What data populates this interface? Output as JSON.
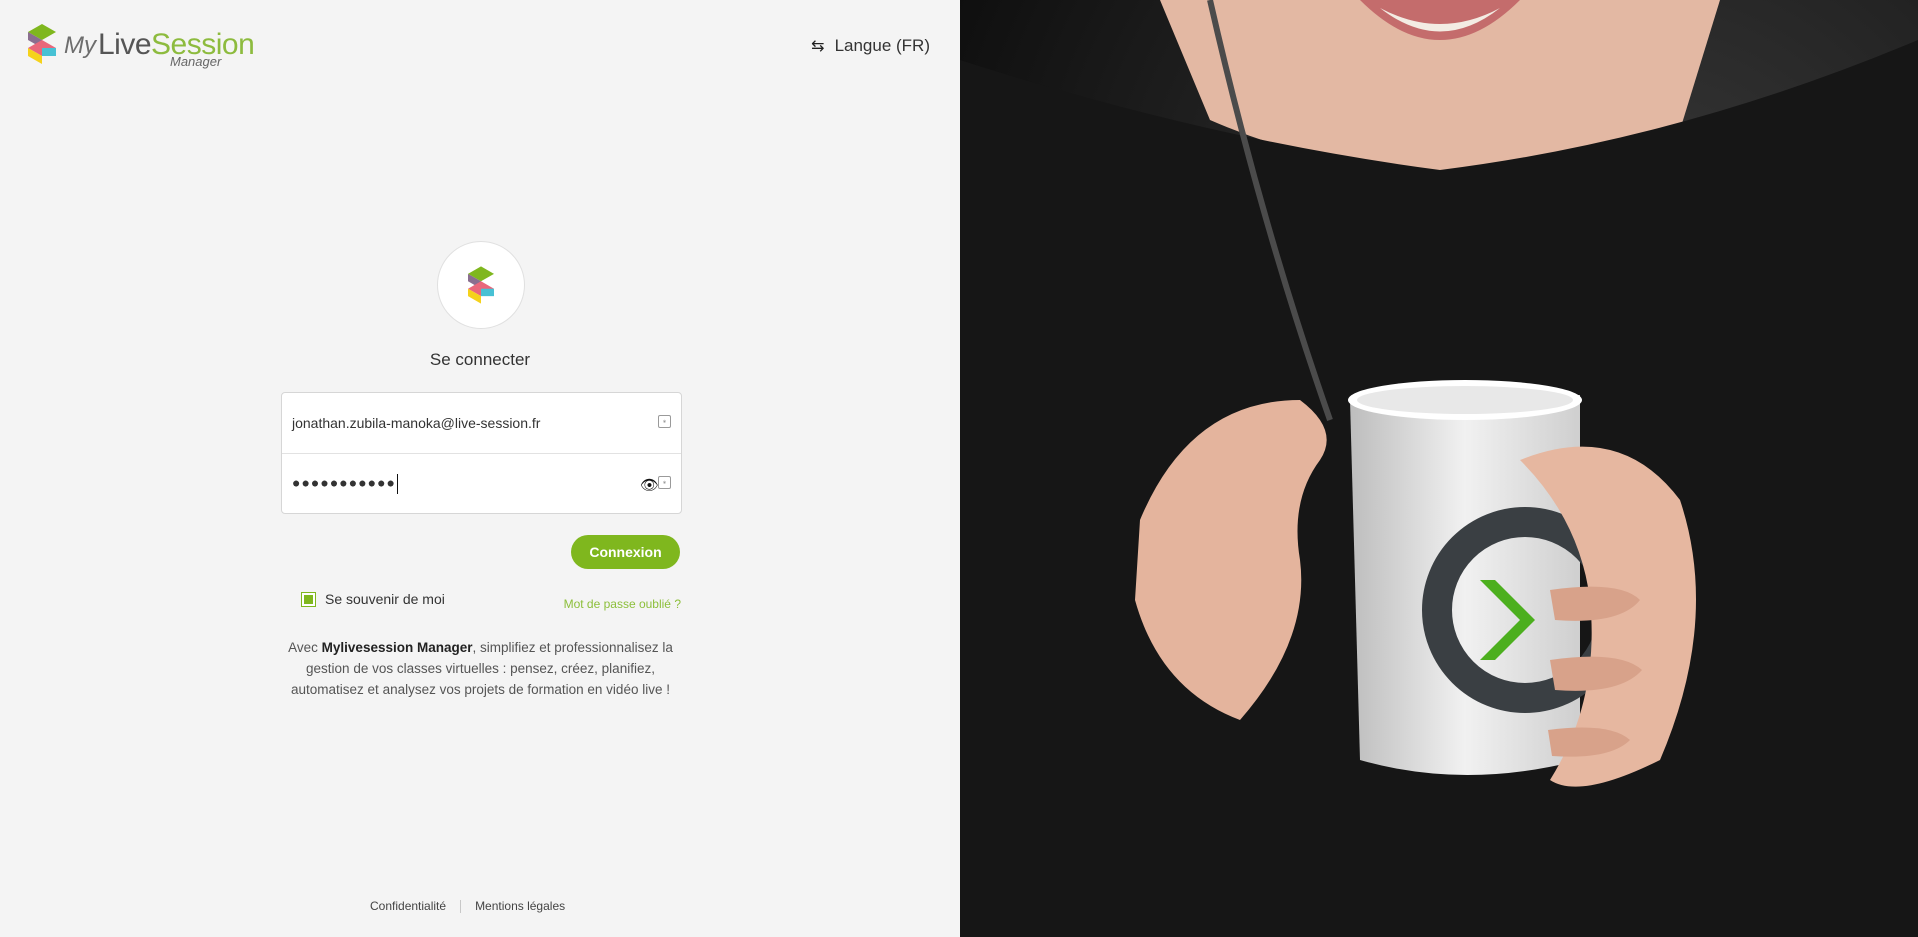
{
  "header": {
    "logo_my": "My",
    "logo_live": "Live",
    "logo_session": "Session",
    "logo_manager": "Manager",
    "language_label": "Langue (FR)"
  },
  "login": {
    "title": "Se connecter",
    "email_value": "jonathan.zubila-manoka@live-session.fr",
    "password_value": "●●●●●●●●●●●",
    "submit_label": "Connexion",
    "remember_label": "Se souvenir de moi",
    "remember_checked": true,
    "forgot_label": "Mot de passe oublié ?"
  },
  "description": {
    "prefix": "Avec ",
    "brand": "Mylivesession Manager",
    "suffix": ", simplifiez et professionnalisez la gestion de vos classes virtuelles : pensez, créez, planifiez, automatisez et analysez vos projets de formation en vidéo live !"
  },
  "footer": {
    "privacy": "Confidentialité",
    "legal": "Mentions légales"
  },
  "colors": {
    "accent": "#7fb71e",
    "link": "#8cbf3a",
    "background": "#f4f4f4"
  }
}
